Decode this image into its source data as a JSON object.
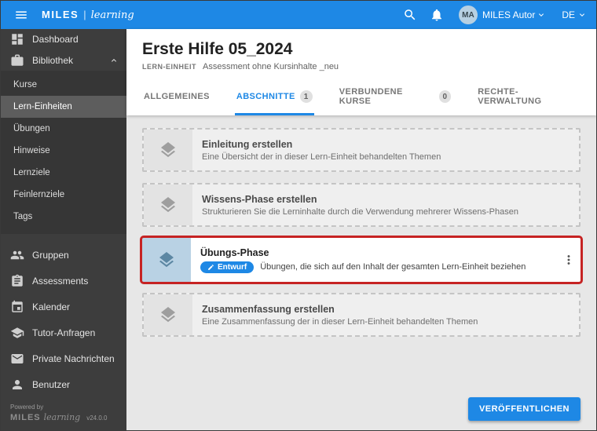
{
  "colors": {
    "topbar": "#1e88e5",
    "accent": "#1e88e5",
    "highlight_border": "#c62323",
    "sidebar": "#3d3d3d"
  },
  "topbar": {
    "brand": "MILES",
    "brand_divider": "|",
    "brand_script": "learning",
    "user": {
      "initials": "MA",
      "name": "MILES Autor"
    },
    "language": "DE"
  },
  "sidebar": {
    "dashboard": "Dashboard",
    "bibliothek": "Bibliothek",
    "library_items": [
      "Kurse",
      "Lern-Einheiten",
      "Übungen",
      "Hinweise",
      "Lernziele",
      "Feinlernziele",
      "Tags"
    ],
    "selected_library_item": "Lern-Einheiten",
    "items": [
      "Gruppen",
      "Assessments",
      "Kalender",
      "Tutor-Anfragen",
      "Private Nachrichten",
      "Benutzer"
    ],
    "footer": {
      "powered_by": "Powered by",
      "brand": "MILES",
      "brand_script": "learning",
      "version": "v24.0.0"
    }
  },
  "main": {
    "title": "Erste Hilfe 05_2024",
    "subtitle_type": "LERN-EINHEIT",
    "subtitle_name": "Assessment ohne Kursinhalte _neu",
    "tabs": [
      {
        "label": "ALLGEMEINES",
        "active": false
      },
      {
        "label": "ABSCHNITTE",
        "badge": "1",
        "active": true
      },
      {
        "label": "VERBUNDENE KURSE",
        "badge": "0",
        "active": false
      },
      {
        "label": "RECHTE-VERWALTUNG",
        "active": false
      }
    ],
    "sections": [
      {
        "title": "Einleitung erstellen",
        "description": "Eine Übersicht der in dieser Lern-Einheit behandelten Themen",
        "state": "placeholder"
      },
      {
        "title": "Wissens-Phase erstellen",
        "description": "Strukturieren Sie die Lerninhalte durch die Verwendung mehrerer Wissens-Phasen",
        "state": "placeholder"
      },
      {
        "title": "Übungs-Phase",
        "status_badge": "Entwurf",
        "description": "Übungen, die sich auf den Inhalt der gesamten Lern-Einheit beziehen",
        "state": "draft",
        "highlighted": true
      },
      {
        "title": "Zusammenfassung erstellen",
        "description": "Eine Zusammenfassung der in dieser Lern-Einheit behandelten Themen",
        "state": "placeholder"
      }
    ],
    "publish_button": "VERÖFFENTLICHEN"
  }
}
